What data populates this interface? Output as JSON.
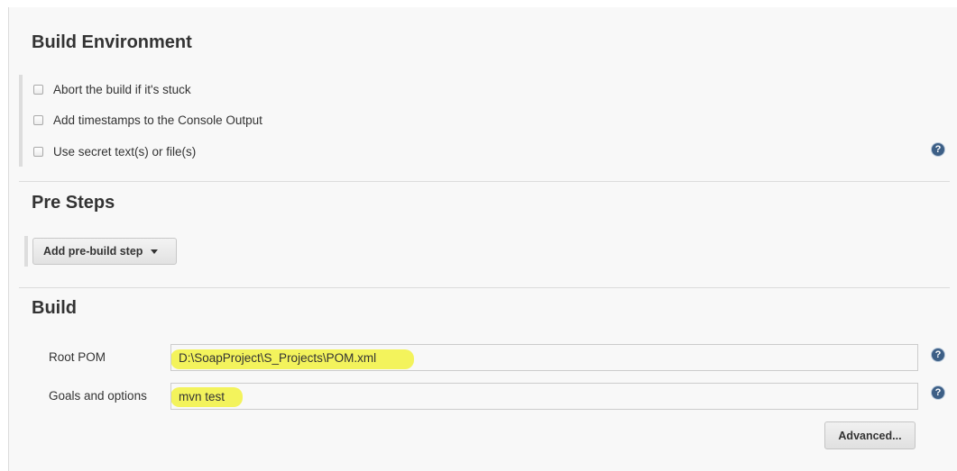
{
  "build_environment": {
    "title": "Build Environment",
    "options": [
      {
        "label": "Abort the build if it's stuck",
        "checked": false
      },
      {
        "label": "Add timestamps to the Console Output",
        "checked": false
      },
      {
        "label": "Use secret text(s) or file(s)",
        "checked": false
      }
    ],
    "help_icon": "question-circle"
  },
  "pre_steps": {
    "title": "Pre Steps",
    "add_button_label": "Add pre-build step"
  },
  "build": {
    "title": "Build",
    "root_pom": {
      "label": "Root POM",
      "value": "D:\\SoapProject\\S_Projects\\POM.xml"
    },
    "goals": {
      "label": "Goals and options",
      "value": "mvn test"
    },
    "advanced_button_label": "Advanced...",
    "help_icon": "question-circle"
  },
  "colors": {
    "panel_bg": "#f8f8f8",
    "highlight": "#f3f35c",
    "help_icon": "#3d5f86"
  }
}
